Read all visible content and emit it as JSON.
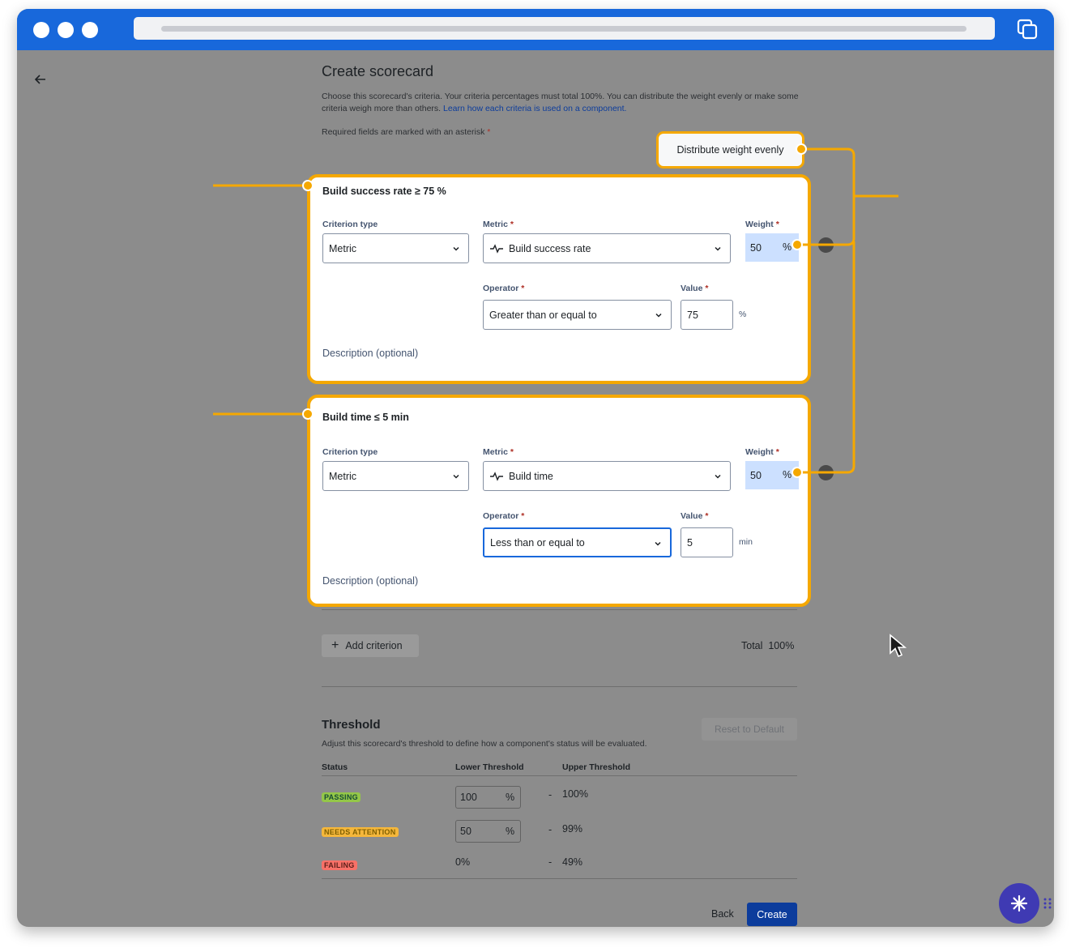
{
  "page": {
    "title": "Create scorecard",
    "intro_text": "Choose this scorecard's criteria. Your criteria percentages must total 100%. You can distribute the weight evenly or make some criteria weigh more than others.",
    "intro_link": "Learn how each criteria is used on a component.",
    "required_note": "Required fields are marked with an asterisk",
    "required_star": "*"
  },
  "distribute_button": "Distribute weight evenly",
  "labels": {
    "criterion_type": "Criterion type",
    "metric": "Metric",
    "weight": "Weight",
    "operator": "Operator",
    "value": "Value",
    "description": "Description (optional)"
  },
  "criteria": [
    {
      "title": "Build success rate ≥ 75 %",
      "criterion_type": "Metric",
      "metric": "Build success rate",
      "weight": "50",
      "weight_unit": "%",
      "operator": "Greater than or equal to",
      "value": "75",
      "value_unit": "%"
    },
    {
      "title": "Build time ≤ 5 min",
      "criterion_type": "Metric",
      "metric": "Build time",
      "weight": "50",
      "weight_unit": "%",
      "operator": "Less than or equal to",
      "value": "5",
      "value_unit": "min"
    }
  ],
  "add_criterion": "Add criterion",
  "total": {
    "label": "Total",
    "value": "100%"
  },
  "threshold": {
    "title": "Threshold",
    "reset_button": "Reset to Default",
    "description": "Adjust this scorecard's threshold to define how a component's status will be evaluated.",
    "columns": [
      "Status",
      "Lower Threshold",
      "Upper Threshold"
    ],
    "rows": [
      {
        "status": "PASSING",
        "lower": "100",
        "lower_unit": "%",
        "upper": "100%"
      },
      {
        "status": "NEEDS ATTENTION",
        "lower": "50",
        "lower_unit": "%",
        "upper": "99%"
      },
      {
        "status": "FAILING",
        "lower": "0%",
        "upper": "49%"
      }
    ],
    "dash": "-"
  },
  "footer": {
    "back": "Back",
    "create": "Create"
  },
  "colors": {
    "highlight": "#f5a800",
    "primary": "#0c3c9c",
    "titlebar": "#1868db",
    "weight_bg": "#cce0ff"
  },
  "icons": [
    "back-arrow-icon",
    "chevron-down-icon",
    "pulse-icon",
    "plus-icon",
    "copy-icon",
    "asterisk-icon",
    "drag-dots-icon",
    "mouse-cursor-icon"
  ]
}
